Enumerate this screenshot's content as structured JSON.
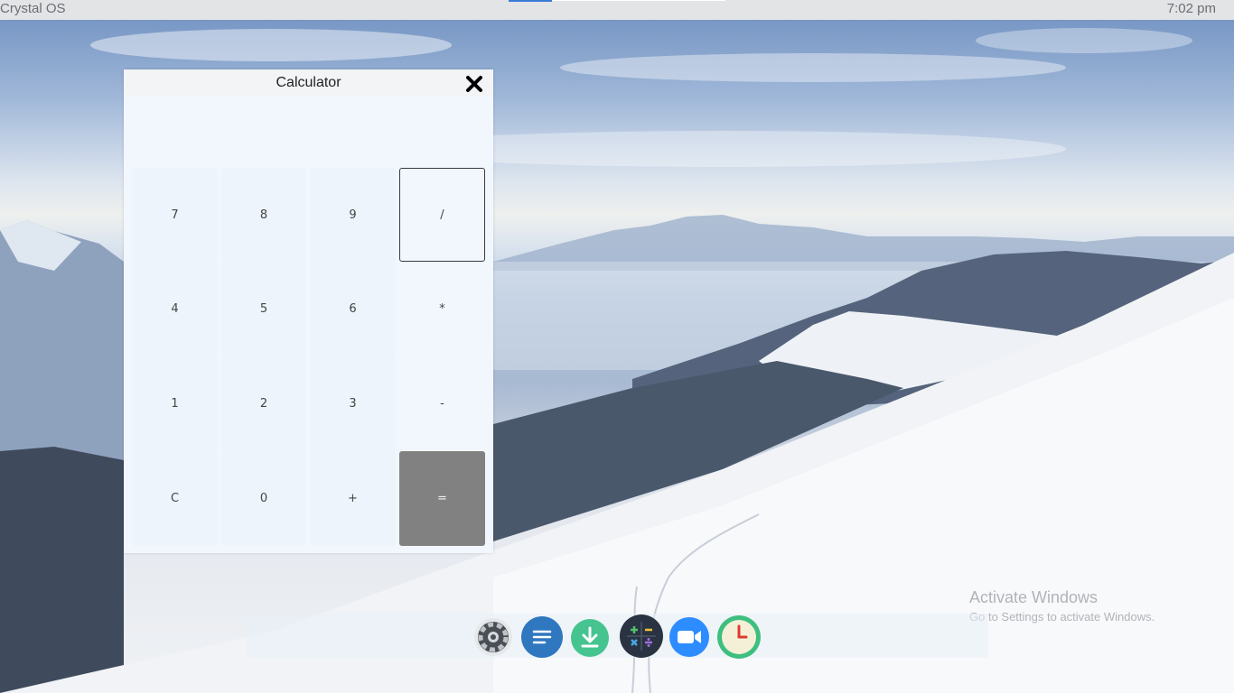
{
  "topbar": {
    "os_name": "Crystal OS",
    "time": "7:02 pm"
  },
  "calculator": {
    "title": "Calculator",
    "display": "",
    "keys": [
      "7",
      "8",
      "9",
      "/",
      "4",
      "5",
      "6",
      "*",
      "1",
      "2",
      "3",
      "-",
      "C",
      "0",
      "+",
      "="
    ]
  },
  "watermark": {
    "title": "Activate Windows",
    "subtitle": "Go to Settings to activate Windows."
  },
  "dock": {
    "apps": [
      "settings-icon",
      "notes-icon",
      "download-icon",
      "calculator-icon",
      "video-call-icon",
      "clock-icon"
    ]
  },
  "colors": {
    "accent_blue": "#3a7bd5",
    "notes_blue": "#2f78c0",
    "download_green": "#45c48f",
    "video_blue": "#2d8cff",
    "clock_green": "#3fbf7f",
    "calc_dark": "#2a3342",
    "equals_gray": "#818181"
  }
}
